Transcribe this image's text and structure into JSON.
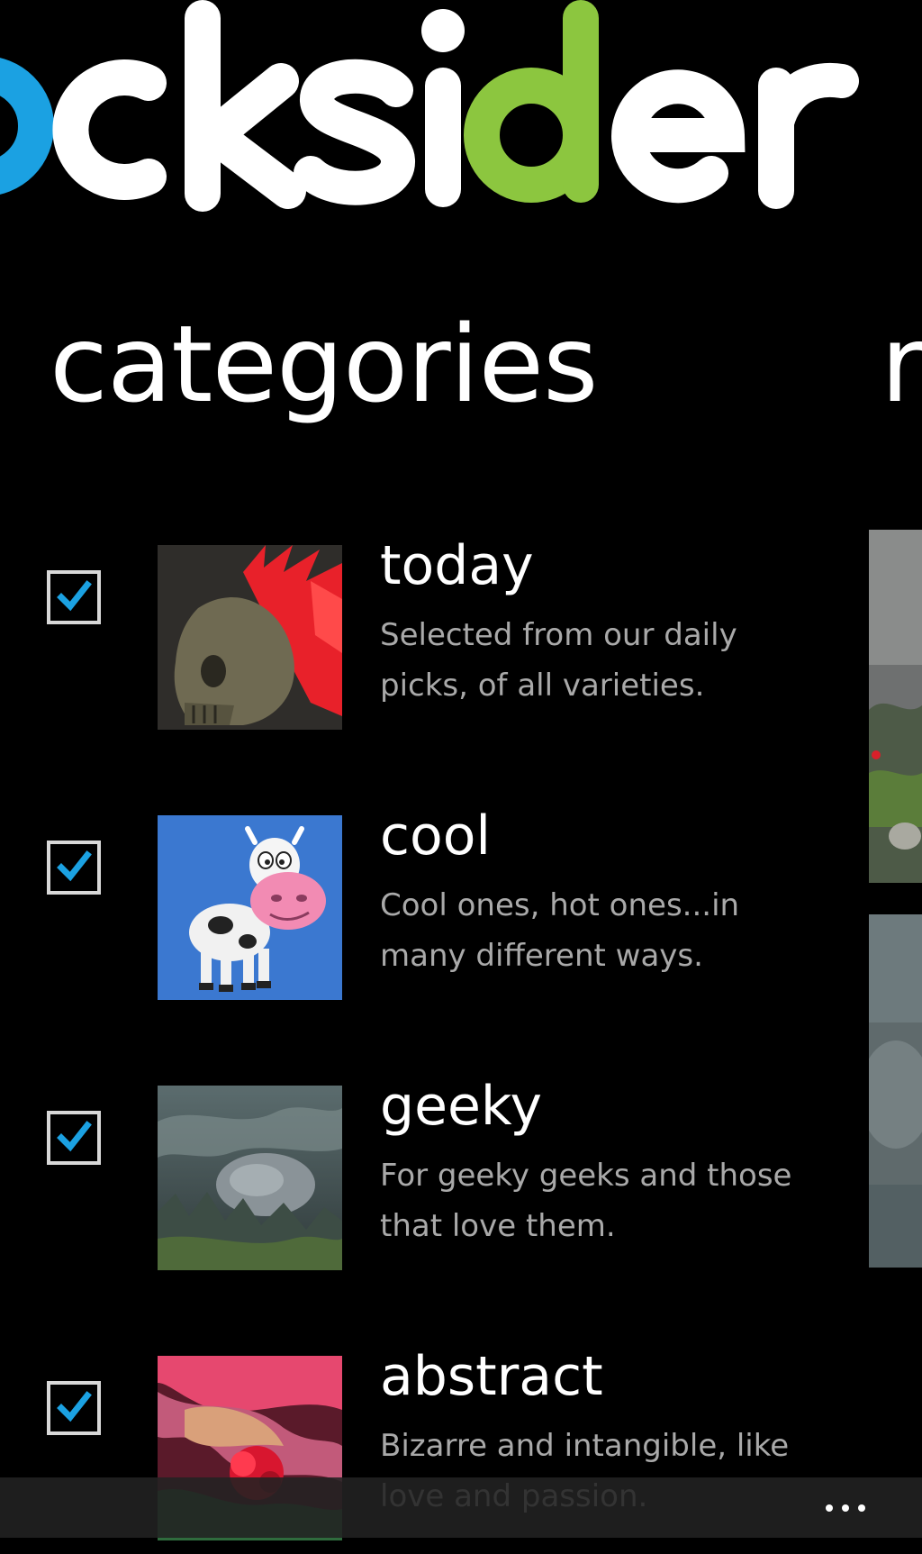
{
  "app": {
    "logo_text": "locksider",
    "accent_colors": {
      "blue": "#1ba1e2",
      "green": "#8cc63f",
      "white": "#ffffff"
    }
  },
  "pivot": {
    "current": "categories",
    "next_peek": "r"
  },
  "categories": [
    {
      "title": "today",
      "description": "Selected from our daily picks, of all varieties.",
      "checked": true,
      "thumbnail": "skull-red-mohawk"
    },
    {
      "title": "cool",
      "description": "Cool ones, hot ones...in many different ways.",
      "checked": true,
      "thumbnail": "cartoon-cow"
    },
    {
      "title": "geeky",
      "description": "For geeky geeks and those that love them.",
      "checked": true,
      "thumbnail": "stormy-landscape"
    },
    {
      "title": "abstract",
      "description": "Bizarre and intangible, like love and passion.",
      "checked": true,
      "thumbnail": "abstract-flower"
    }
  ],
  "app_bar": {
    "more_icon": "ellipsis-icon"
  },
  "colors": {
    "background": "#000000",
    "checkmark": "#1ba1e2",
    "secondary_text": "#a9a9a9",
    "cow_background": "#3b78d0"
  }
}
